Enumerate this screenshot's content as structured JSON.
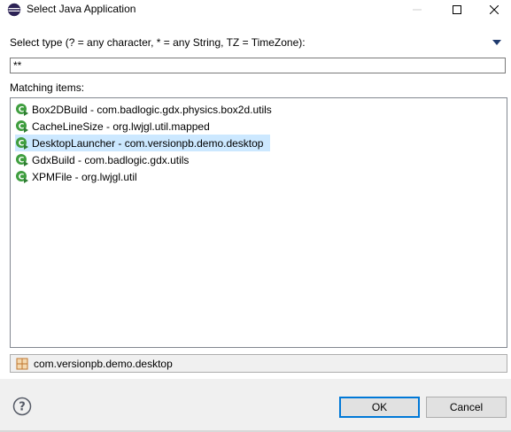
{
  "window": {
    "title": "Select Java Application"
  },
  "filter": {
    "label": "Select type (? = any character, * = any String, TZ = TimeZone):",
    "value": "**"
  },
  "matching": {
    "label": "Matching items:",
    "items": [
      {
        "text": "Box2DBuild - com.badlogic.gdx.physics.box2d.utils",
        "icon": "java-class-main-icon",
        "selected": false
      },
      {
        "text": "CacheLineSize - org.lwjgl.util.mapped",
        "icon": "java-class-main-icon",
        "selected": false
      },
      {
        "text": "DesktopLauncher - com.versionpb.demo.desktop",
        "icon": "java-class-main-icon",
        "selected": true
      },
      {
        "text": "GdxBuild - com.badlogic.gdx.utils",
        "icon": "java-class-main-icon",
        "selected": false
      },
      {
        "text": "XPMFile - org.lwjgl.util",
        "icon": "java-class-main-icon",
        "selected": false
      }
    ]
  },
  "status": {
    "package": "com.versionpb.demo.desktop",
    "icon": "package-icon"
  },
  "buttons": {
    "ok": "OK",
    "cancel": "Cancel"
  },
  "colors": {
    "selection": "#cce8ff",
    "class_icon_green": "#3f9e3f",
    "package_icon": "#c07830",
    "accent": "#0078d7"
  }
}
